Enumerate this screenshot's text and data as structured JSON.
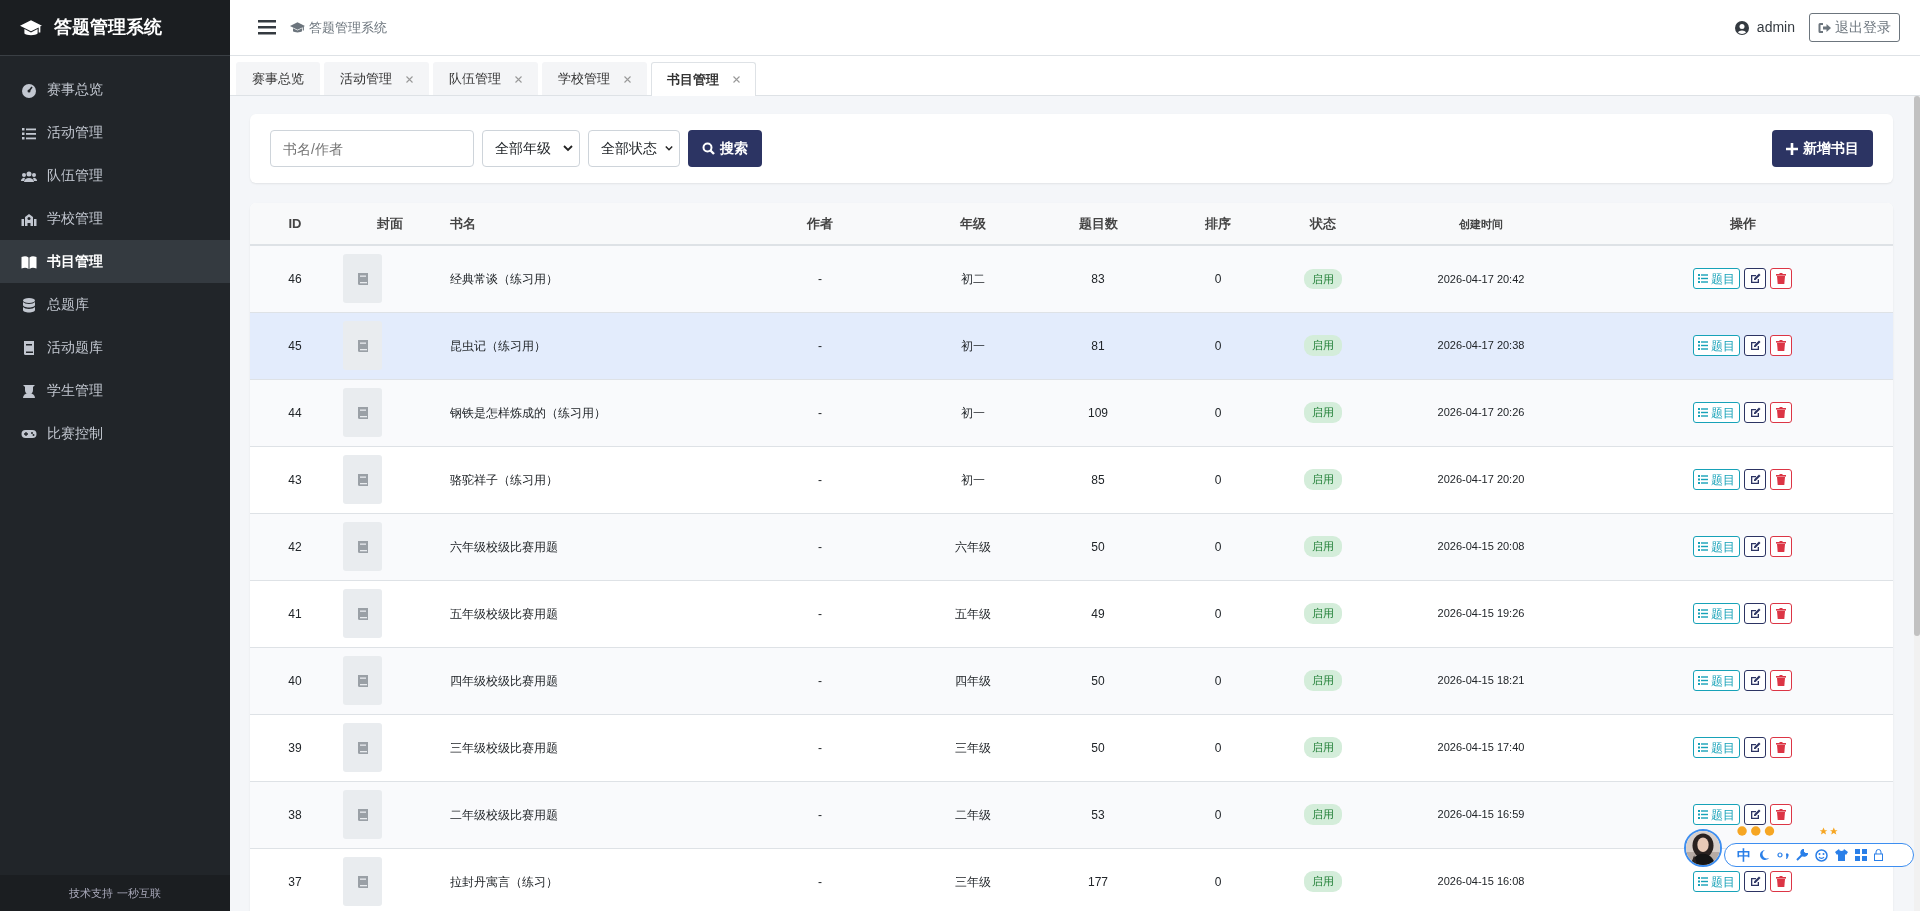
{
  "sidebar": {
    "brand": "答题管理系统",
    "items": [
      {
        "label": "赛事总览",
        "selected": false
      },
      {
        "label": "活动管理",
        "selected": false
      },
      {
        "label": "队伍管理",
        "selected": false
      },
      {
        "label": "学校管理",
        "selected": false
      },
      {
        "label": "书目管理",
        "selected": true
      },
      {
        "label": "总题库",
        "selected": false
      },
      {
        "label": "活动题库",
        "selected": false
      },
      {
        "label": "学生管理",
        "selected": false
      },
      {
        "label": "比赛控制",
        "selected": false
      }
    ],
    "footer": "技术支持 一秒互联"
  },
  "topbar": {
    "title": "答题管理系统",
    "user": "admin",
    "logout": "退出登录"
  },
  "tabs": [
    {
      "label": "赛事总览",
      "closable": false,
      "selected": false
    },
    {
      "label": "活动管理",
      "closable": true,
      "selected": false
    },
    {
      "label": "队伍管理",
      "closable": true,
      "selected": false
    },
    {
      "label": "学校管理",
      "closable": true,
      "selected": false
    },
    {
      "label": "书目管理",
      "closable": true,
      "selected": true
    }
  ],
  "filters": {
    "search": {
      "placeholder": "书名/作者"
    },
    "grade": "全部年级",
    "status": "全部状态",
    "search_button": "搜索",
    "add_button": "新增书目"
  },
  "table": {
    "columns": [
      "ID",
      "封面",
      "书名",
      "作者",
      "年级",
      "题目数",
      "排序",
      "状态",
      "创建时间",
      "操作"
    ],
    "rows": [
      {
        "id": "46",
        "title": "经典常谈（练习用）",
        "author": "-",
        "grade": "初二",
        "questions": "83",
        "order": "0",
        "status": {
          "kind": "enabled",
          "label": "启用"
        },
        "created": "2026-04-17 20:42",
        "questions_button": "题目",
        "hovered": false
      },
      {
        "id": "45",
        "title": "昆虫记（练习用）",
        "author": "-",
        "grade": "初一",
        "questions": "81",
        "order": "0",
        "status": {
          "kind": "enabled",
          "label": "启用"
        },
        "created": "2026-04-17 20:38",
        "questions_button": "题目",
        "hovered": true
      },
      {
        "id": "44",
        "title": "钢铁是怎样炼成的（练习用）",
        "author": "-",
        "grade": "初一",
        "questions": "109",
        "order": "0",
        "status": {
          "kind": "enabled",
          "label": "启用"
        },
        "created": "2026-04-17 20:26",
        "questions_button": "题目",
        "hovered": false
      },
      {
        "id": "43",
        "title": "骆驼祥子（练习用）",
        "author": "-",
        "grade": "初一",
        "questions": "85",
        "order": "0",
        "status": {
          "kind": "enabled",
          "label": "启用"
        },
        "created": "2026-04-17 20:20",
        "questions_button": "题目",
        "hovered": false
      },
      {
        "id": "42",
        "title": "六年级校级比赛用题",
        "author": "-",
        "grade": "六年级",
        "questions": "50",
        "order": "0",
        "status": {
          "kind": "enabled",
          "label": "启用"
        },
        "created": "2026-04-15 20:08",
        "questions_button": "题目",
        "hovered": false
      },
      {
        "id": "41",
        "title": "五年级校级比赛用题",
        "author": "-",
        "grade": "五年级",
        "questions": "49",
        "order": "0",
        "status": {
          "kind": "enabled",
          "label": "启用"
        },
        "created": "2026-04-15 19:26",
        "questions_button": "题目",
        "hovered": false
      },
      {
        "id": "40",
        "title": "四年级校级比赛用题",
        "author": "-",
        "grade": "四年级",
        "questions": "50",
        "order": "0",
        "status": {
          "kind": "enabled",
          "label": "启用"
        },
        "created": "2026-04-15 18:21",
        "questions_button": "题目",
        "hovered": false
      },
      {
        "id": "39",
        "title": "三年级校级比赛用题",
        "author": "-",
        "grade": "三年级",
        "questions": "50",
        "order": "0",
        "status": {
          "kind": "enabled",
          "label": "启用"
        },
        "created": "2026-04-15 17:40",
        "questions_button": "题目",
        "hovered": false
      },
      {
        "id": "38",
        "title": "二年级校级比赛用题",
        "author": "-",
        "grade": "二年级",
        "questions": "53",
        "order": "0",
        "status": {
          "kind": "enabled",
          "label": "启用"
        },
        "created": "2026-04-15 16:59",
        "questions_button": "题目",
        "hovered": false
      },
      {
        "id": "37",
        "title": "拉封丹寓言（练习）",
        "author": "-",
        "grade": "三年级",
        "questions": "177",
        "order": "0",
        "status": {
          "kind": "enabled",
          "label": "启用"
        },
        "created": "2026-04-15 16:08",
        "questions_button": "题目",
        "hovered": false
      }
    ]
  },
  "ime_toolbar": {
    "mode": "中"
  }
}
